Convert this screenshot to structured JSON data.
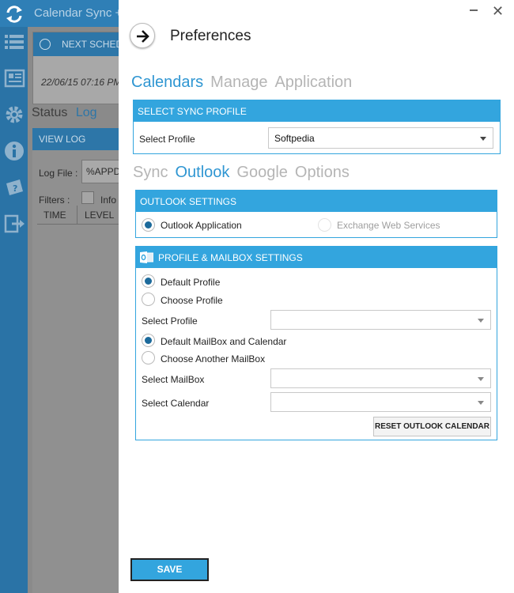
{
  "background_app": {
    "title": "Calendar Sync +",
    "next_schedule_label": "NEXT SCHEDU",
    "next_schedule_value": "22/06/15 07:16 PM",
    "tabs": {
      "status": "Status",
      "log": "Log"
    },
    "view_log_label": "VIEW LOG",
    "log_file_label": "Log File :",
    "log_file_value": "%APPDA",
    "filters_label": "Filters :",
    "filter_info": "Info",
    "columns": {
      "time": "TIME",
      "level": "LEVEL"
    }
  },
  "preferences": {
    "title": "Preferences",
    "main_tabs": {
      "calendars": "Calendars",
      "manage": "Manage",
      "application": "Application"
    },
    "sync_profile": {
      "header": "SELECT SYNC PROFILE",
      "select_label": "Select Profile",
      "selected_value": "Softpedia"
    },
    "sub_tabs": {
      "sync": "Sync",
      "outlook": "Outlook",
      "google": "Google",
      "options": "Options"
    },
    "outlook_settings": {
      "header": "OUTLOOK SETTINGS",
      "option_application": "Outlook Application",
      "option_ews": "Exchange Web Services"
    },
    "profile_mailbox": {
      "header": "PROFILE & MAILBOX SETTINGS",
      "default_profile": "Default Profile",
      "choose_profile": "Choose Profile",
      "select_profile_label": "Select Profile",
      "default_mailbox": "Default MailBox and Calendar",
      "choose_mailbox": "Choose Another MailBox",
      "select_mailbox_label": "Select MailBox",
      "select_calendar_label": "Select Calendar",
      "reset_button": "RESET OUTLOOK CALENDAR"
    },
    "save_button": "SAVE",
    "close_glyph": "✕"
  },
  "colors": {
    "accent": "#33a5de",
    "active_tab": "#2f96d2",
    "radio_fill": "#1c6a9b"
  }
}
